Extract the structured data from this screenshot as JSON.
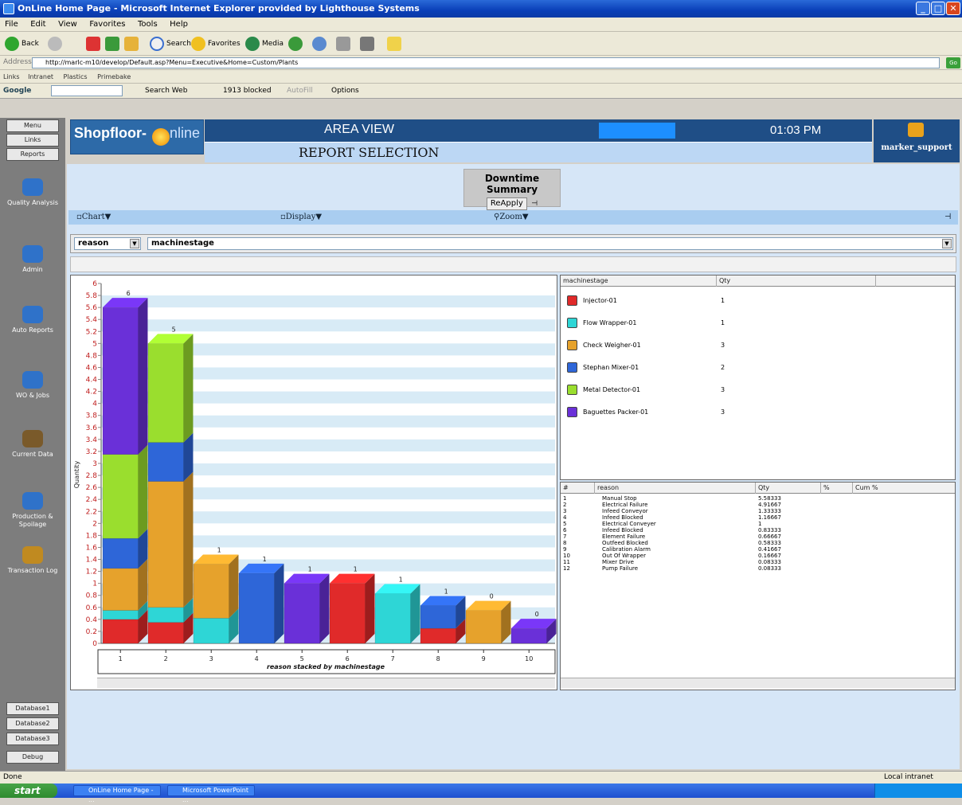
{
  "window": {
    "title": "OnLine Home Page - Microsoft Internet Explorer provided by Lighthouse Systems"
  },
  "menu": [
    "File",
    "Edit",
    "View",
    "Favorites",
    "Tools",
    "Help"
  ],
  "toolbar": {
    "back": "Back",
    "search": "Search",
    "favorites": "Favorites",
    "media": "Media"
  },
  "address": {
    "label": "Address",
    "url": "http://marlc-m10/develop/Default.asp?Menu=Executive&Home=Custom/Plants",
    "go": "Go"
  },
  "links": {
    "label": "Links",
    "items": [
      "Intranet",
      "Plastics",
      "Primebake"
    ]
  },
  "google": {
    "label": "Google",
    "search_web": "Search Web",
    "blocked": "1913 blocked",
    "autofill": "AutoFill",
    "options": "Options"
  },
  "nav": {
    "top_buttons": [
      "Menu",
      "Links",
      "Reports"
    ],
    "items": [
      {
        "label": "Quality Analysis",
        "color": "#2f72c9"
      },
      {
        "label": "Admin",
        "color": "#2f72c9"
      },
      {
        "label": "Auto Reports",
        "color": "#2f72c9"
      },
      {
        "label": "WO & Jobs",
        "color": "#2f72c9"
      },
      {
        "label": "Current Data",
        "color": "#7a5a2a"
      },
      {
        "label": "Production & Spoilage",
        "color": "#2f72c9"
      },
      {
        "label": "Transaction Log",
        "color": "#c08a20"
      }
    ],
    "bottom_buttons": [
      "Database1",
      "Database2",
      "Database3",
      "Debug"
    ]
  },
  "header": {
    "logo_left": "Shopfloor-",
    "logo_right": "nline",
    "area_title": "AREA VIEW",
    "time": "01:03 PM",
    "subtitle": "REPORT SELECTION",
    "user": "marker_support"
  },
  "summary": {
    "title": "Downtime Summary",
    "reapply": "ReApply"
  },
  "options": {
    "chart": "Chart",
    "display": "Display",
    "zoom": "Zoom"
  },
  "selectors": {
    "group_by": "reason",
    "stack_by": "machinestage"
  },
  "colors": {
    "red": "#e02a2a",
    "cyan": "#2ed6d6",
    "orange": "#e6a22c",
    "blue": "#2e66d8",
    "green": "#9ade2e",
    "purple": "#6a30d8"
  },
  "chart_data": {
    "type": "bar",
    "stacked": true,
    "xlabel": "reason stacked by machinestage",
    "ylabel": "Quantity",
    "ylim": [
      0,
      6
    ],
    "yticks": [
      "0",
      "0.2",
      "0.4",
      "0.6",
      "0.8",
      "1",
      "1.2",
      "1.4",
      "1.6",
      "1.8",
      "2",
      "2.2",
      "2.4",
      "2.6",
      "2.8",
      "3",
      "3.2",
      "3.4",
      "3.6",
      "3.8",
      "4",
      "4.2",
      "4.4",
      "4.6",
      "4.8",
      "5",
      "5.2",
      "5.4",
      "5.6",
      "5.8",
      "6"
    ],
    "categories": [
      "1",
      "2",
      "3",
      "4",
      "5",
      "6",
      "7",
      "8",
      "9",
      "10"
    ],
    "top_labels": [
      "6",
      "5",
      "1",
      "1",
      "1",
      "1",
      "1",
      "1",
      "0",
      "0"
    ],
    "series": [
      {
        "name": "Injector-01",
        "color": "#e02a2a",
        "values": [
          0.4,
          0.35,
          0,
          0,
          0,
          1.0,
          0,
          0.25,
          0,
          0
        ]
      },
      {
        "name": "Flow Wrapper-01",
        "color": "#2ed6d6",
        "values": [
          0.15,
          0.25,
          0.42,
          0,
          0,
          0,
          0.83,
          0,
          0,
          0
        ]
      },
      {
        "name": "Check Weigher-01",
        "color": "#e6a22c",
        "values": [
          0.7,
          2.1,
          0.9,
          0,
          0,
          0,
          0,
          0,
          0.55,
          0
        ]
      },
      {
        "name": "Stephan Mixer-01",
        "color": "#2e66d8",
        "values": [
          0.5,
          0.65,
          0,
          1.17,
          0,
          0,
          0,
          0.38,
          0,
          0
        ]
      },
      {
        "name": "Metal Detector-01",
        "color": "#9ade2e",
        "values": [
          1.4,
          1.65,
          0,
          0,
          0,
          0,
          0,
          0,
          0,
          0
        ]
      },
      {
        "name": "Baguettes Packer-01",
        "color": "#6a30d8",
        "values": [
          2.45,
          0,
          0,
          0,
          1.0,
          0,
          0,
          0,
          0,
          0.25
        ]
      }
    ]
  },
  "legend": {
    "headers": [
      "machinestage",
      "Qty"
    ],
    "rows": [
      {
        "name": "Injector-01",
        "qty": "1",
        "color": "#e02a2a"
      },
      {
        "name": "Flow Wrapper-01",
        "qty": "1",
        "color": "#2ed6d6"
      },
      {
        "name": "Check Weigher-01",
        "qty": "3",
        "color": "#e6a22c"
      },
      {
        "name": "Stephan Mixer-01",
        "qty": "2",
        "color": "#2e66d8"
      },
      {
        "name": "Metal Detector-01",
        "qty": "3",
        "color": "#9ade2e"
      },
      {
        "name": "Baguettes Packer-01",
        "qty": "3",
        "color": "#6a30d8"
      }
    ]
  },
  "reasons": {
    "headers": [
      "#",
      "reason",
      "Qty",
      "%",
      "Cum %"
    ],
    "rows": [
      {
        "n": "1",
        "reason": "Manual Stop",
        "qty": "5.58333"
      },
      {
        "n": "2",
        "reason": "Electrical Failure",
        "qty": "4.91667"
      },
      {
        "n": "3",
        "reason": "Infeed Conveyor",
        "qty": "1.33333"
      },
      {
        "n": "4",
        "reason": "Infeed Blocked",
        "qty": "1.16667"
      },
      {
        "n": "5",
        "reason": "Electrical Conveyer",
        "qty": "1"
      },
      {
        "n": "6",
        "reason": "Infeed Blocked",
        "qty": "0.83333"
      },
      {
        "n": "7",
        "reason": "Element Failure",
        "qty": "0.66667"
      },
      {
        "n": "8",
        "reason": "Outfeed Blocked",
        "qty": "0.58333"
      },
      {
        "n": "9",
        "reason": "Calibration Alarm",
        "qty": "0.41667"
      },
      {
        "n": "10",
        "reason": "Out Of Wrapper",
        "qty": "0.16667"
      },
      {
        "n": "11",
        "reason": "Mixer Drive",
        "qty": "0.08333"
      },
      {
        "n": "12",
        "reason": "Pump Failure",
        "qty": "0.08333"
      }
    ]
  },
  "status": {
    "left": "Done",
    "right": "Local intranet"
  },
  "taskbar": {
    "start": "start",
    "tasks": [
      "OnLine Home Page - ...",
      "Microsoft PowerPoint ..."
    ]
  }
}
